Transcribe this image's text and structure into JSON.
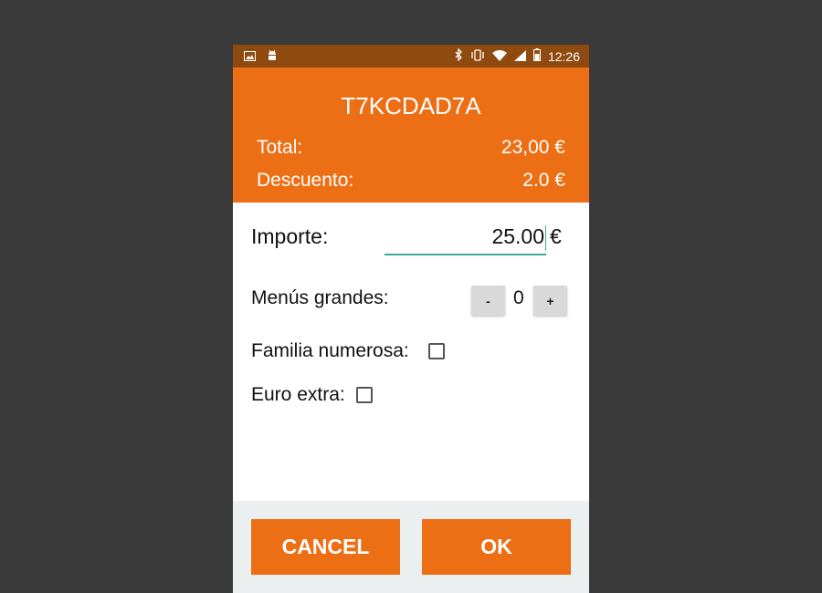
{
  "status_bar": {
    "time": "12:26",
    "left_icons": [
      "image-icon",
      "android-icon"
    ],
    "right_icons": [
      "bluetooth-icon",
      "vibrate-icon",
      "wifi-icon",
      "signal-icon",
      "battery-icon"
    ]
  },
  "header": {
    "code": "T7KCDAD7A",
    "total_label": "Total:",
    "total_value": "23,00 €",
    "descuento_label": "Descuento:",
    "descuento_value": "2.0 €"
  },
  "form": {
    "importe_label": "Importe:",
    "importe_value": "25.00",
    "importe_currency": "€",
    "menus_label": "Menús grandes:",
    "menus_minus": "-",
    "menus_count": "0",
    "menus_plus": "+",
    "familia_label": "Familia numerosa:",
    "familia_checked": false,
    "euro_extra_label": "Euro extra:",
    "euro_extra_checked": false
  },
  "buttons": {
    "cancel": "CANCEL",
    "ok": "OK"
  },
  "colors": {
    "accent": "#ed6f15",
    "status_bar": "#8f4a10",
    "input_underline": "#3fa99a",
    "background": "#3a3a3a"
  }
}
